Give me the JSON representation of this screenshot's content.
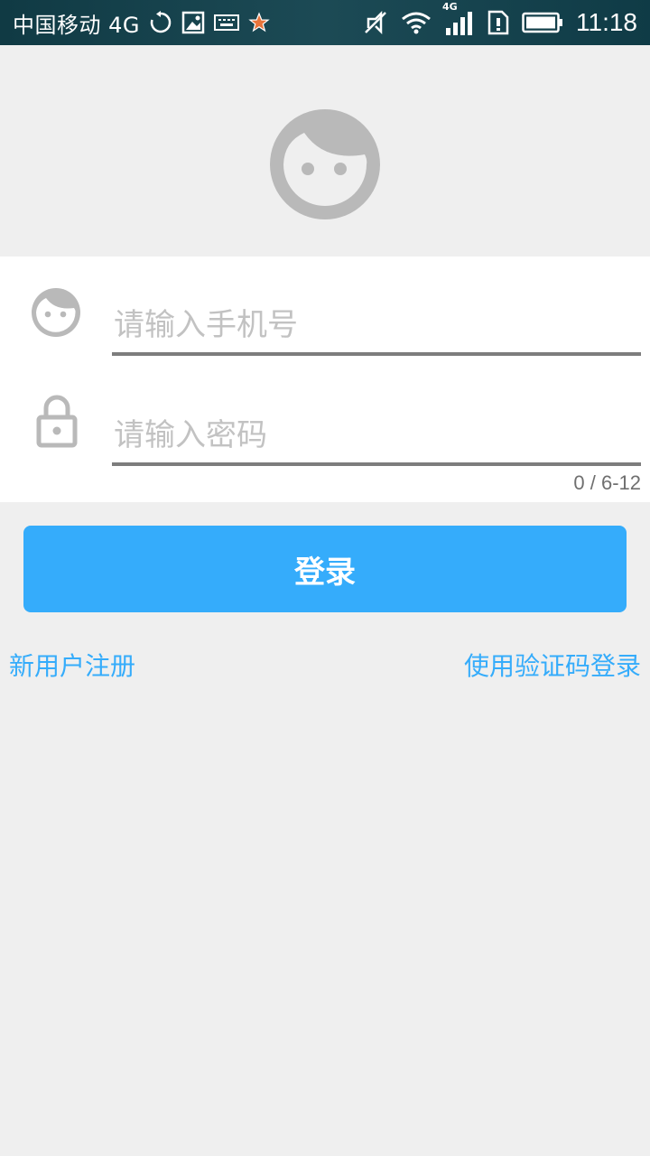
{
  "status_bar": {
    "carrier": "中国移动 4G",
    "network_label": "4G",
    "time": "11:18"
  },
  "form": {
    "phone_placeholder": "请输入手机号",
    "password_placeholder": "请输入密码",
    "password_counter": "0 / 6-12"
  },
  "buttons": {
    "login_label": "登录"
  },
  "links": {
    "register": "新用户注册",
    "sms_login": "使用验证码登录"
  },
  "colors": {
    "accent": "#35acfb",
    "icon_gray": "#b9b9b9",
    "status_bar": "#103a44"
  }
}
